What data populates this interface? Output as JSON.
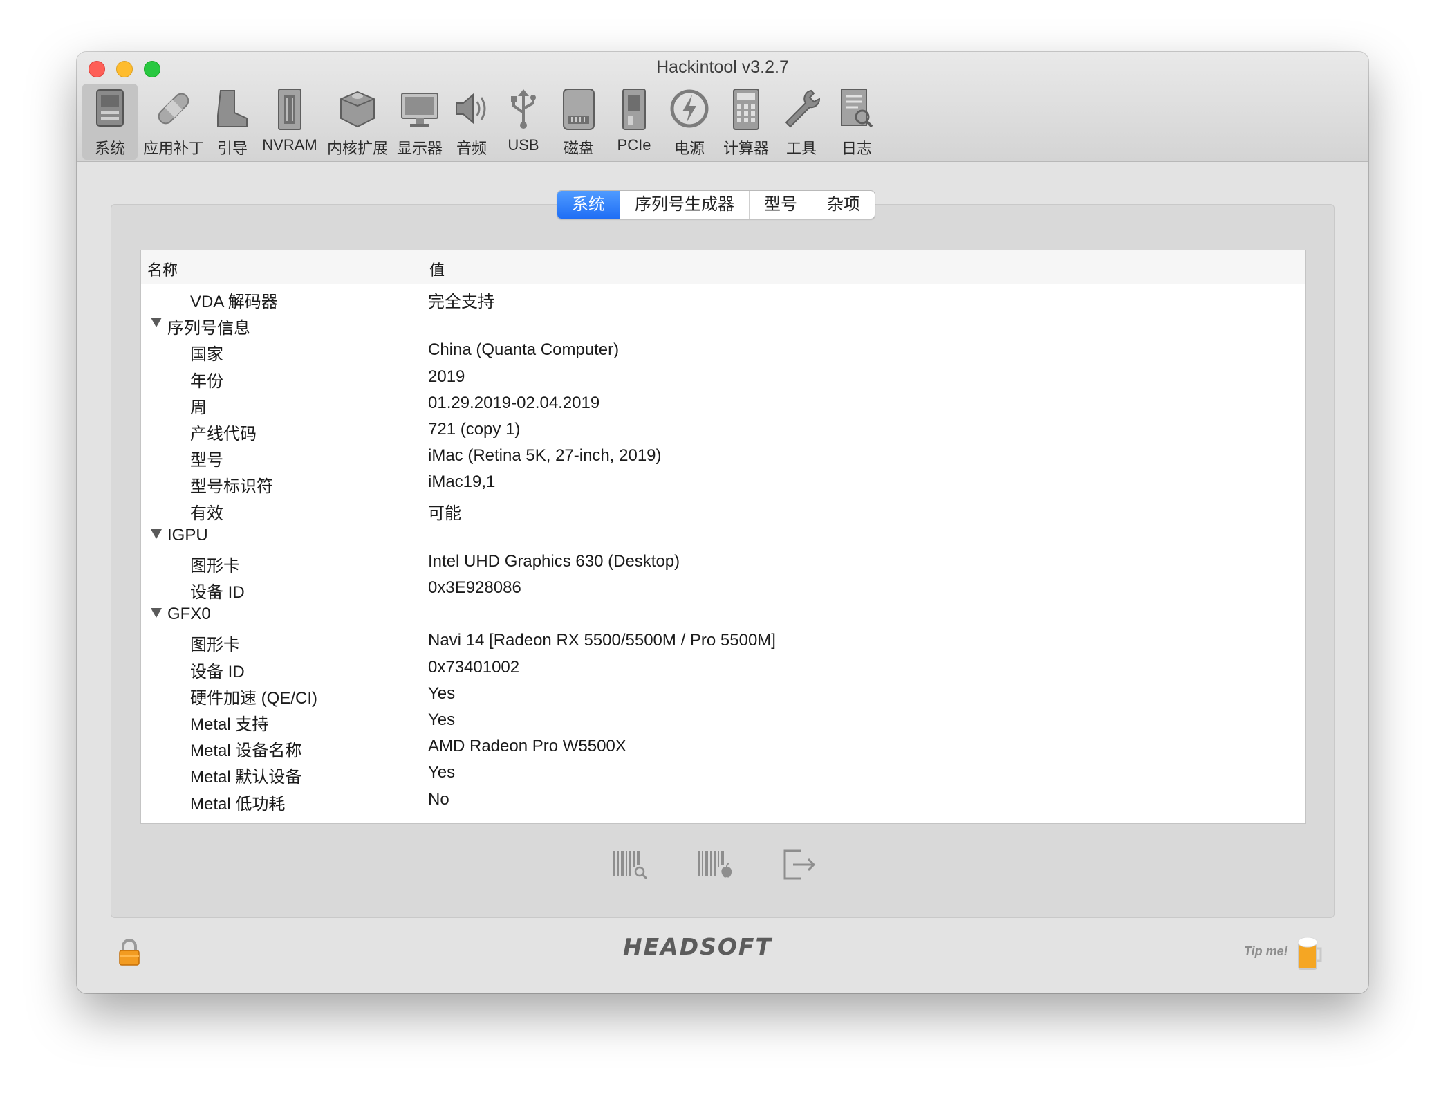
{
  "window": {
    "title": "Hackintool v3.2.7"
  },
  "toolbar": [
    {
      "label": "系统",
      "icon": "system-icon"
    },
    {
      "label": "应用补丁",
      "icon": "patch-icon"
    },
    {
      "label": "引导",
      "icon": "boot-icon"
    },
    {
      "label": "NVRAM",
      "icon": "nvram-icon"
    },
    {
      "label": "内核扩展",
      "icon": "kext-icon"
    },
    {
      "label": "显示器",
      "icon": "display-icon"
    },
    {
      "label": "音频",
      "icon": "audio-icon"
    },
    {
      "label": "USB",
      "icon": "usb-icon"
    },
    {
      "label": "磁盘",
      "icon": "disk-icon"
    },
    {
      "label": "PCIe",
      "icon": "pcie-icon"
    },
    {
      "label": "电源",
      "icon": "power-icon"
    },
    {
      "label": "计算器",
      "icon": "calculator-icon"
    },
    {
      "label": "工具",
      "icon": "tools-icon"
    },
    {
      "label": "日志",
      "icon": "log-icon"
    }
  ],
  "tabs": [
    "系统",
    "序列号生成器",
    "型号",
    "杂项"
  ],
  "table": {
    "headers": {
      "name": "名称",
      "value": "值"
    },
    "rows": [
      {
        "k": "VDA 解码器",
        "v": "完全支持",
        "t": "child"
      },
      {
        "k": "序列号信息",
        "v": "",
        "t": "group"
      },
      {
        "k": "国家",
        "v": "China (Quanta Computer)",
        "t": "child"
      },
      {
        "k": "年份",
        "v": "2019",
        "t": "child"
      },
      {
        "k": "周",
        "v": "01.29.2019-02.04.2019",
        "t": "child"
      },
      {
        "k": "产线代码",
        "v": "721 (copy 1)",
        "t": "child"
      },
      {
        "k": "型号",
        "v": "iMac (Retina 5K, 27-inch, 2019)",
        "t": "child"
      },
      {
        "k": "型号标识符",
        "v": "iMac19,1",
        "t": "child"
      },
      {
        "k": "有效",
        "v": "可能",
        "t": "child"
      },
      {
        "k": "IGPU",
        "v": "",
        "t": "group"
      },
      {
        "k": "图形卡",
        "v": "Intel UHD Graphics 630 (Desktop)",
        "t": "child"
      },
      {
        "k": "设备 ID",
        "v": "0x3E928086",
        "t": "child"
      },
      {
        "k": "GFX0",
        "v": "",
        "t": "group"
      },
      {
        "k": "图形卡",
        "v": "Navi 14 [Radeon RX 5500/5500M / Pro 5500M]",
        "t": "child"
      },
      {
        "k": "设备 ID",
        "v": "0x73401002",
        "t": "child"
      },
      {
        "k": "硬件加速 (QE/CI)",
        "v": "Yes",
        "t": "child"
      },
      {
        "k": "Metal 支持",
        "v": "Yes",
        "t": "child"
      },
      {
        "k": "Metal 设备名称",
        "v": "AMD Radeon Pro W5500X",
        "t": "child"
      },
      {
        "k": "Metal 默认设备",
        "v": "Yes",
        "t": "child"
      },
      {
        "k": "Metal 低功耗",
        "v": "No",
        "t": "child"
      }
    ]
  },
  "footer": {
    "brand": "HEADSOFT",
    "tip": "Tip me!"
  }
}
